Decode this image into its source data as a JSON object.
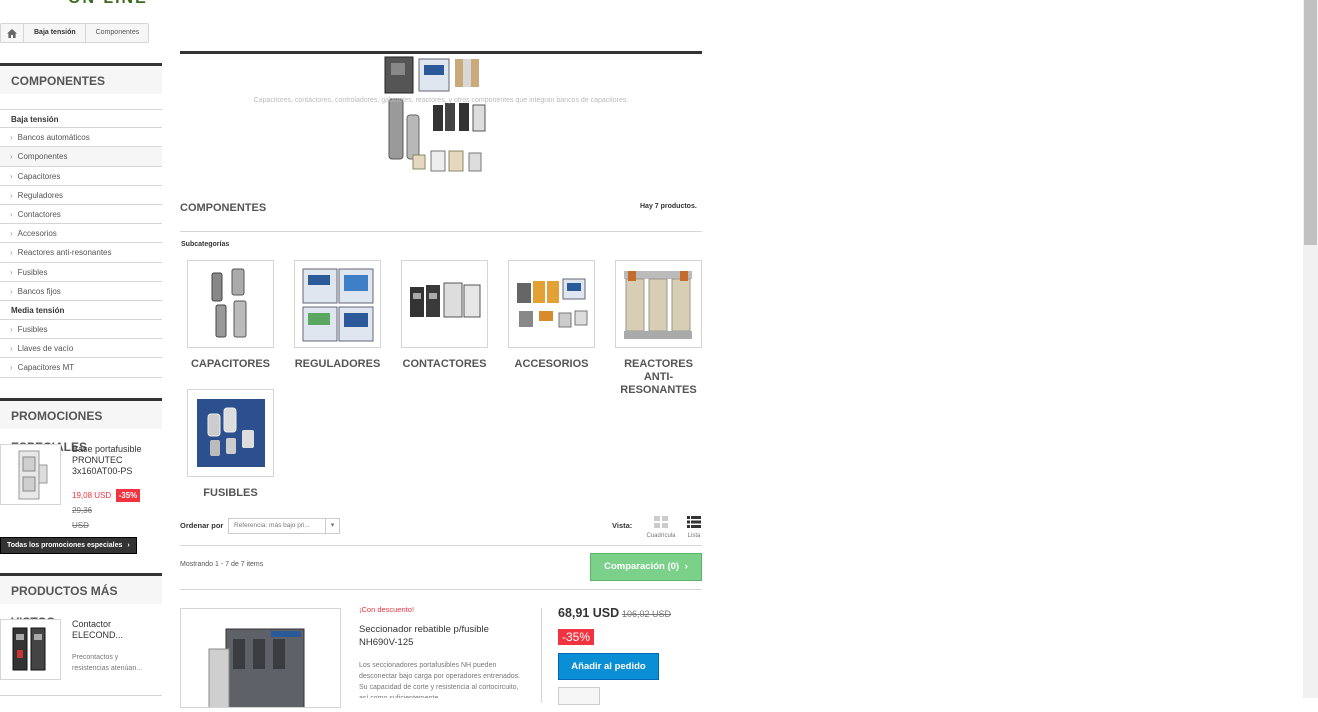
{
  "logo": {
    "text": "ON-LINE"
  },
  "breadcrumb": {
    "home_icon": "home-icon",
    "items": [
      "Baja tensión",
      "Componentes"
    ]
  },
  "sidebar": {
    "categories_title": "COMPONENTES",
    "categories": [
      {
        "label": "Baja tensión",
        "type": "head"
      },
      {
        "label": "Bancos automáticos",
        "type": "item"
      },
      {
        "label": "Componentes",
        "type": "item",
        "selected": true
      },
      {
        "label": "Capacitores",
        "type": "item"
      },
      {
        "label": "Reguladores",
        "type": "item"
      },
      {
        "label": "Contactores",
        "type": "item"
      },
      {
        "label": "Accesorios",
        "type": "item"
      },
      {
        "label": "Reactores anti-resonantes",
        "type": "item"
      },
      {
        "label": "Fusibles",
        "type": "item"
      },
      {
        "label": "Bancos fijos",
        "type": "item"
      },
      {
        "label": "Media tensión",
        "type": "head"
      },
      {
        "label": "Fusibles",
        "type": "item"
      },
      {
        "label": "Llaves de vacío",
        "type": "item"
      },
      {
        "label": "Capacitores MT",
        "type": "item"
      }
    ],
    "promo": {
      "title": "PROMOCIONES ESPECIALES",
      "product_name": "Base portafusible PRONUTEC 3x160AT00-PS",
      "price": "19,08 USD",
      "discount": "-35%",
      "old_price": "29,36",
      "old_price_currency": "USD",
      "all_button": "Todas los promociones especiales"
    },
    "viewed": {
      "title": "PRODUCTOS MÁS VISTOS",
      "product_name": "Contactor ELECOND...",
      "product_desc": "Precontactos y resistencias atenúan..."
    }
  },
  "main": {
    "category_description": "Capacitores, contactores, controladores, gabinetes, reactores, y otros componentes que integran bancos de capacitores.",
    "heading": "COMPONENTES",
    "product_count": "Hay 7 productos.",
    "subcategories_label": "Subcategorías",
    "subcategories": [
      {
        "name": "CAPACITORES",
        "name2": ""
      },
      {
        "name": "REGULADORES",
        "name2": ""
      },
      {
        "name": "CONTACTORES",
        "name2": ""
      },
      {
        "name": "ACCESORIOS",
        "name2": ""
      },
      {
        "name": "REACTORES",
        "name2": "ANTI-RESONANTES"
      },
      {
        "name": "FUSIBLES",
        "name2": ""
      }
    ],
    "sort_label": "Ordenar por",
    "sort_value": "Referencia: más bajo pri...",
    "view_label": "Vista:",
    "view_grid": "Cuadrícula",
    "view_list": "Lista",
    "showing": "Mostrando 1 - 7 de 7 items",
    "compare_button": "Comparación (0)",
    "product": {
      "tag": "¡Con descuento!",
      "name": "Seccionador rebatible p/fusible NH690V-125",
      "desc": "Los seccionadores portafusibles NH pueden desconectar bajo carga por operadores entrenados. Su capacidad de corte y resistencia al cortocircuito, así como suficientemente...",
      "price": "68,91 USD",
      "old_price": "106,02 USD",
      "discount": "-35%",
      "add_button": "Añadir al pedido"
    }
  },
  "colors": {
    "accent_red": "#f13340",
    "add_blue": "#0a8ed4",
    "compare_green": "#7bd08a",
    "dark": "#333333"
  }
}
